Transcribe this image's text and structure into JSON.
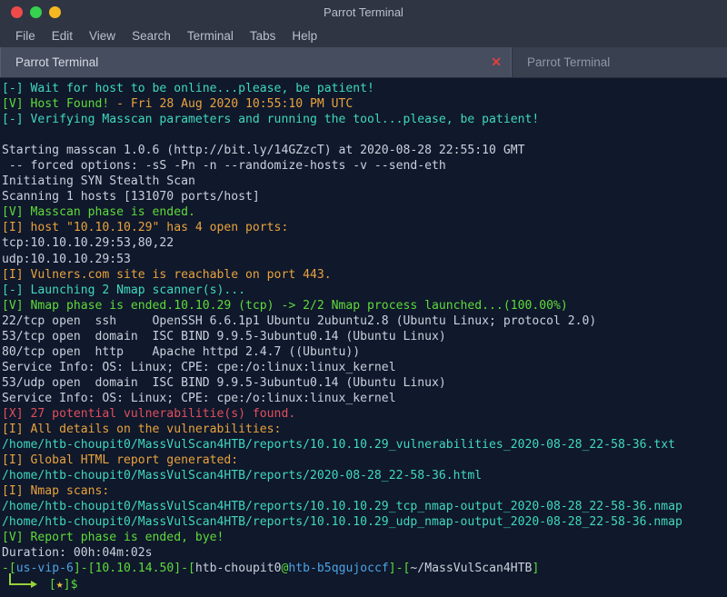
{
  "window": {
    "title": "Parrot Terminal",
    "controls": [
      {
        "name": "close",
        "color": "#f04a4a"
      },
      {
        "name": "minimize",
        "color": "#35d14f"
      },
      {
        "name": "maximize",
        "color": "#f5b821"
      }
    ]
  },
  "menubar": {
    "items": [
      "File",
      "Edit",
      "View",
      "Search",
      "Terminal",
      "Tabs",
      "Help"
    ]
  },
  "tabs": [
    {
      "label": "Parrot Terminal",
      "active": true,
      "close_glyph": "✕"
    },
    {
      "label": "Parrot Terminal",
      "active": false
    }
  ],
  "colors": {
    "background": "#10182b",
    "chrome": "#2f3542",
    "cyan": "#3fd8c0",
    "green": "#5ddb3b",
    "amber": "#e8a33d",
    "red": "#e14f5e",
    "white": "#c9d1de",
    "blue": "#4ba3e3",
    "star": "#f0c040"
  },
  "terminal": {
    "lines": [
      {
        "id": "l01",
        "segments": [
          {
            "text": "[-] Wait for host to be online...please, be patient!",
            "color": "cyan"
          }
        ]
      },
      {
        "id": "l02",
        "segments": [
          {
            "text": "[V] Host Found! ",
            "color": "green"
          },
          {
            "text": "- Fri 28 Aug 2020 10:55:10 PM UTC",
            "color": "amber"
          }
        ]
      },
      {
        "id": "l03",
        "segments": [
          {
            "text": "[-] Verifying Masscan parameters and running the tool...please, be patient!",
            "color": "cyan"
          }
        ]
      },
      {
        "id": "l04",
        "segments": [
          {
            "text": "",
            "color": "white"
          }
        ]
      },
      {
        "id": "l05",
        "segments": [
          {
            "text": "Starting masscan 1.0.6 (http://bit.ly/14GZzcT) at 2020-08-28 22:55:10 GMT",
            "color": "white"
          }
        ]
      },
      {
        "id": "l06",
        "segments": [
          {
            "text": " -- forced options: -sS -Pn -n --randomize-hosts -v --send-eth",
            "color": "white"
          }
        ]
      },
      {
        "id": "l07",
        "segments": [
          {
            "text": "Initiating SYN Stealth Scan",
            "color": "white"
          }
        ]
      },
      {
        "id": "l08",
        "segments": [
          {
            "text": "Scanning 1 hosts [131070 ports/host]",
            "color": "white"
          }
        ]
      },
      {
        "id": "l09",
        "segments": [
          {
            "text": "[V] Masscan phase is ended.",
            "color": "green"
          }
        ]
      },
      {
        "id": "l10",
        "segments": [
          {
            "text": "[I] host \"10.10.10.29\" has 4 open ports:",
            "color": "amber"
          }
        ]
      },
      {
        "id": "l11",
        "segments": [
          {
            "text": "tcp:10.10.10.29:53,80,22",
            "color": "white"
          }
        ]
      },
      {
        "id": "l12",
        "segments": [
          {
            "text": "udp:10.10.10.29:53",
            "color": "white"
          }
        ]
      },
      {
        "id": "l13",
        "segments": [
          {
            "text": "[I] Vulners.com site is reachable on port 443.",
            "color": "amber"
          }
        ]
      },
      {
        "id": "l14",
        "segments": [
          {
            "text": "[-] Launching 2 Nmap scanner(s)...",
            "color": "cyan"
          }
        ]
      },
      {
        "id": "l15",
        "segments": [
          {
            "text": "[V] Nmap phase is ended.10.10.29 (tcp) -> 2/2 Nmap process launched...(100.00%)",
            "color": "green"
          }
        ]
      },
      {
        "id": "l16",
        "segments": [
          {
            "text": "22/tcp open  ssh     OpenSSH 6.6.1p1 Ubuntu 2ubuntu2.8 (Ubuntu Linux; protocol 2.0)",
            "color": "white"
          }
        ]
      },
      {
        "id": "l17",
        "segments": [
          {
            "text": "53/tcp open  domain  ISC BIND 9.9.5-3ubuntu0.14 (Ubuntu Linux)",
            "color": "white"
          }
        ]
      },
      {
        "id": "l18",
        "segments": [
          {
            "text": "80/tcp open  http    Apache httpd 2.4.7 ((Ubuntu))",
            "color": "white"
          }
        ]
      },
      {
        "id": "l19",
        "segments": [
          {
            "text": "Service Info: OS: Linux; CPE: cpe:/o:linux:linux_kernel",
            "color": "white"
          }
        ]
      },
      {
        "id": "l20",
        "segments": [
          {
            "text": "53/udp open  domain  ISC BIND 9.9.5-3ubuntu0.14 (Ubuntu Linux)",
            "color": "white"
          }
        ]
      },
      {
        "id": "l21",
        "segments": [
          {
            "text": "Service Info: OS: Linux; CPE: cpe:/o:linux:linux_kernel",
            "color": "white"
          }
        ]
      },
      {
        "id": "l22",
        "segments": [
          {
            "text": "[X] 27 potential vulnerabilitie(s) found.",
            "color": "red"
          }
        ]
      },
      {
        "id": "l23",
        "segments": [
          {
            "text": "[I] All details on the vulnerabilities:",
            "color": "amber"
          }
        ]
      },
      {
        "id": "l24",
        "segments": [
          {
            "text": "/home/htb-choupit0/MassVulScan4HTB/reports/10.10.10.29_vulnerabilities_2020-08-28_22-58-36.txt",
            "color": "cyan"
          }
        ]
      },
      {
        "id": "l25",
        "segments": [
          {
            "text": "[I] Global HTML report generated:",
            "color": "amber"
          }
        ]
      },
      {
        "id": "l26",
        "segments": [
          {
            "text": "/home/htb-choupit0/MassVulScan4HTB/reports/2020-08-28_22-58-36.html",
            "color": "cyan"
          }
        ]
      },
      {
        "id": "l27",
        "segments": [
          {
            "text": "[I] Nmap scans:",
            "color": "amber"
          }
        ]
      },
      {
        "id": "l28",
        "segments": [
          {
            "text": "/home/htb-choupit0/MassVulScan4HTB/reports/10.10.10.29_tcp_nmap-output_2020-08-28_22-58-36.nmap",
            "color": "cyan"
          }
        ]
      },
      {
        "id": "l29",
        "segments": [
          {
            "text": "/home/htb-choupit0/MassVulScan4HTB/reports/10.10.10.29_udp_nmap-output_2020-08-28_22-58-36.nmap",
            "color": "cyan"
          }
        ]
      },
      {
        "id": "l30",
        "segments": [
          {
            "text": "[V] Report phase is ended, bye!",
            "color": "green"
          }
        ]
      },
      {
        "id": "l31",
        "segments": [
          {
            "text": "Duration: 00h:04m:02s",
            "color": "white"
          }
        ]
      }
    ],
    "prompt": {
      "line1": [
        {
          "text": "-[",
          "color": "green"
        },
        {
          "text": "us-vip-6",
          "color": "blue"
        },
        {
          "text": "]-[",
          "color": "green"
        },
        {
          "text": "10.10.14.50",
          "color": "green"
        },
        {
          "text": "]-[",
          "color": "green"
        },
        {
          "text": "htb-choupit0",
          "color": "white"
        },
        {
          "text": "@",
          "color": "green"
        },
        {
          "text": "htb-b5qgujoccf",
          "color": "blue"
        },
        {
          "text": "]-[",
          "color": "green"
        },
        {
          "text": "~/MassVulScan4HTB",
          "color": "white"
        },
        {
          "text": "]",
          "color": "green"
        }
      ],
      "line2_bracket_open": "[",
      "line2_star": "★",
      "line2_bracket_close": "]",
      "line2_sigil": "$"
    }
  }
}
